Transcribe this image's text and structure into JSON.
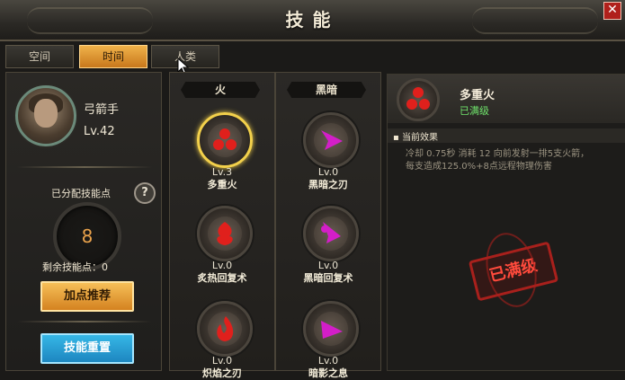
{
  "window": {
    "title": "技能",
    "close_icon": "close-icon"
  },
  "tabs": [
    {
      "label": "空间",
      "active": false
    },
    {
      "label": "时间",
      "active": true
    },
    {
      "label": "人类",
      "active": false
    }
  ],
  "character": {
    "class": "弓箭手",
    "level": "Lv.42"
  },
  "points": {
    "allocated_label": "已分配技能点",
    "allocated_value": "8",
    "remaining_label": "剩余技能点：",
    "remaining_value": "0"
  },
  "buttons": {
    "recommend": "加点推荐",
    "reset": "技能重置"
  },
  "columns": [
    {
      "header": "火",
      "skills": [
        {
          "level": "Lv.3",
          "name": "多重火"
        },
        {
          "level": "Lv.0",
          "name": "炙热回复术"
        },
        {
          "level": "Lv.0",
          "name": "炽焰之刃"
        }
      ]
    },
    {
      "header": "黑暗",
      "skills": [
        {
          "level": "Lv.0",
          "name": "黑暗之刃"
        },
        {
          "level": "Lv.0",
          "name": "黑暗回复术"
        },
        {
          "level": "Lv.0",
          "name": "暗影之息"
        }
      ]
    }
  ],
  "detail": {
    "name": "多重火",
    "status": "已满级",
    "effect_title": "当前效果",
    "line1": "冷却 0.75秒 消耗 12 向前发射一排5支火箭，",
    "line2": "每支造成125.0%+8点远程物理伤害",
    "stamp": "已满级"
  },
  "colors": {
    "fire": "#d8201e",
    "dark": "#d31ec8",
    "max_green": "#6fe36b"
  }
}
